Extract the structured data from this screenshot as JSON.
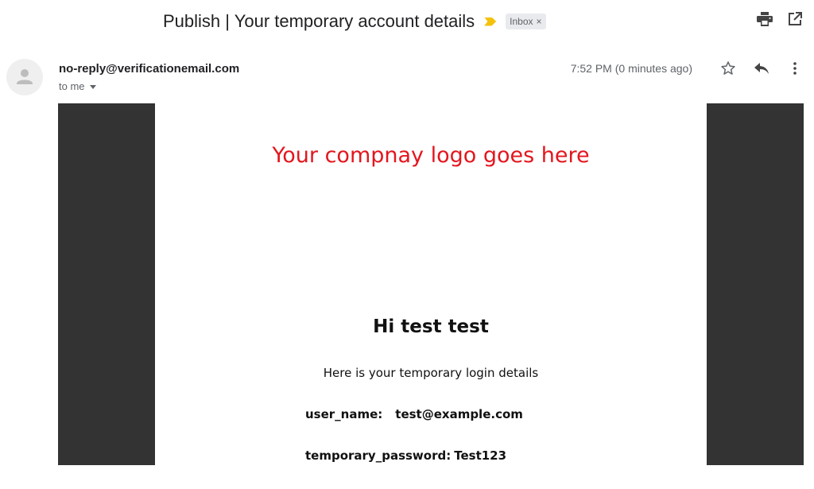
{
  "subject": {
    "title": "Publish | Your temporary account details",
    "label": "Inbox",
    "label_close": "×",
    "importance_icon": "importance-marker-icon",
    "importance_color": "#f4c20d"
  },
  "header_actions": {
    "print_icon": "print-icon",
    "new_window_icon": "open-in-new-window-icon"
  },
  "message": {
    "sender": "no-reply@verificationemail.com",
    "recipient": "to me",
    "timestamp": "7:52 PM (0 minutes ago)",
    "actions": [
      "star-icon",
      "reply-icon",
      "more-vert-icon"
    ]
  },
  "email_body": {
    "logo_text": "Your compnay logo goes here",
    "logo_color": "#e3161e",
    "greeting": "Hi test test",
    "intro": "Here is your temporary login details",
    "username_label": "user_name:",
    "username_value": "test@example.com",
    "password_label": "temporary_password:",
    "password_value": "Test123",
    "gutter_color": "#333333"
  }
}
